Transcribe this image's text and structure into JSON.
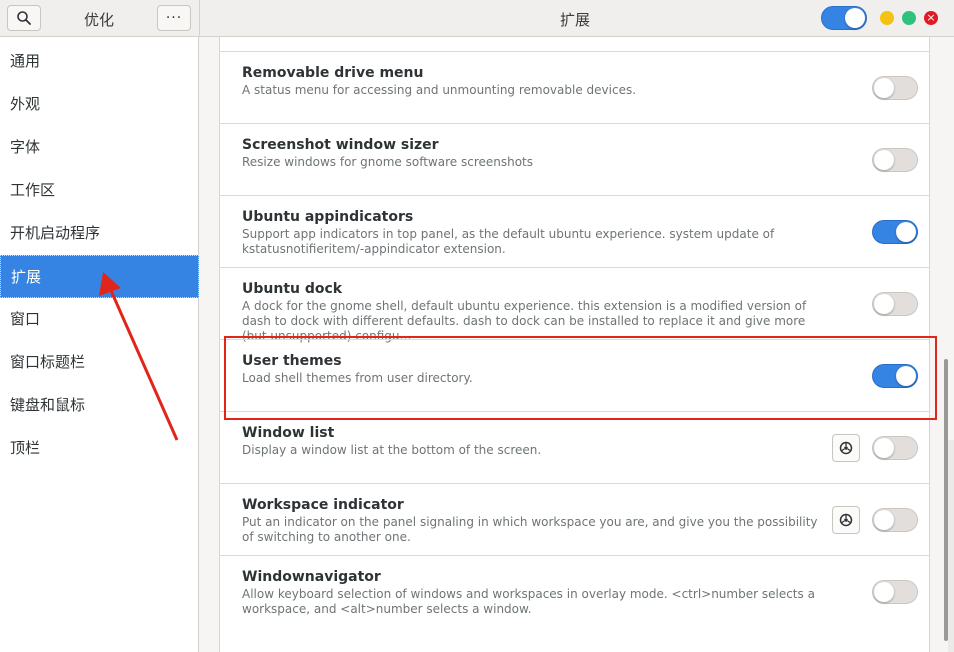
{
  "header": {
    "app_title": "优化",
    "page_title": "扩展",
    "menu_label": "···",
    "global_extensions_enabled": true,
    "window_controls": [
      "minimize",
      "maximize",
      "close"
    ],
    "close_glyph": "×"
  },
  "sidebar": {
    "items": [
      {
        "label": "通用",
        "active": false
      },
      {
        "label": "外观",
        "active": false
      },
      {
        "label": "字体",
        "active": false
      },
      {
        "label": "工作区",
        "active": false
      },
      {
        "label": "开机启动程序",
        "active": false
      },
      {
        "label": "扩展",
        "active": true
      },
      {
        "label": "窗口",
        "active": false
      },
      {
        "label": "窗口标题栏",
        "active": false
      },
      {
        "label": "键盘和鼠标",
        "active": false
      },
      {
        "label": "顶栏",
        "active": false
      }
    ]
  },
  "extensions": [
    {
      "title": "Removable drive menu",
      "description": "A status menu for accessing and unmounting removable devices.",
      "enabled": false,
      "has_settings": false
    },
    {
      "title": "Screenshot window sizer",
      "description": "Resize windows for gnome software screenshots",
      "enabled": false,
      "has_settings": false
    },
    {
      "title": "Ubuntu appindicators",
      "description": "Support app indicators in top panel, as the default ubuntu experience. system update of kstatusnotifieritem/-appindicator extension.",
      "enabled": true,
      "has_settings": false
    },
    {
      "title": "Ubuntu dock",
      "description": "A dock for the gnome shell, default ubuntu experience. this extension is a modified version of dash to dock with different defaults. dash to dock can be installed to replace it and give more (but unsupported) configu…",
      "enabled": false,
      "has_settings": false
    },
    {
      "title": "User themes",
      "description": "Load shell themes from user directory.",
      "enabled": true,
      "has_settings": false
    },
    {
      "title": "Window list",
      "description": "Display a window list at the bottom of the screen.",
      "enabled": false,
      "has_settings": true
    },
    {
      "title": "Workspace indicator",
      "description": "Put an indicator on the panel signaling in which workspace you are, and give you the possibility of switching to another one.",
      "enabled": false,
      "has_settings": true
    },
    {
      "title": "Windownavigator",
      "description": "Allow keyboard selection of windows and workspaces in overlay mode. <ctrl>number selects a workspace, and <alt>number selects a window.",
      "enabled": false,
      "has_settings": false
    }
  ],
  "colors": {
    "accent": "#3584e4",
    "annotation_red": "#e0251b"
  },
  "icons": {
    "search": "search-icon",
    "menu": "more-icon",
    "settings": "gear-icon"
  }
}
